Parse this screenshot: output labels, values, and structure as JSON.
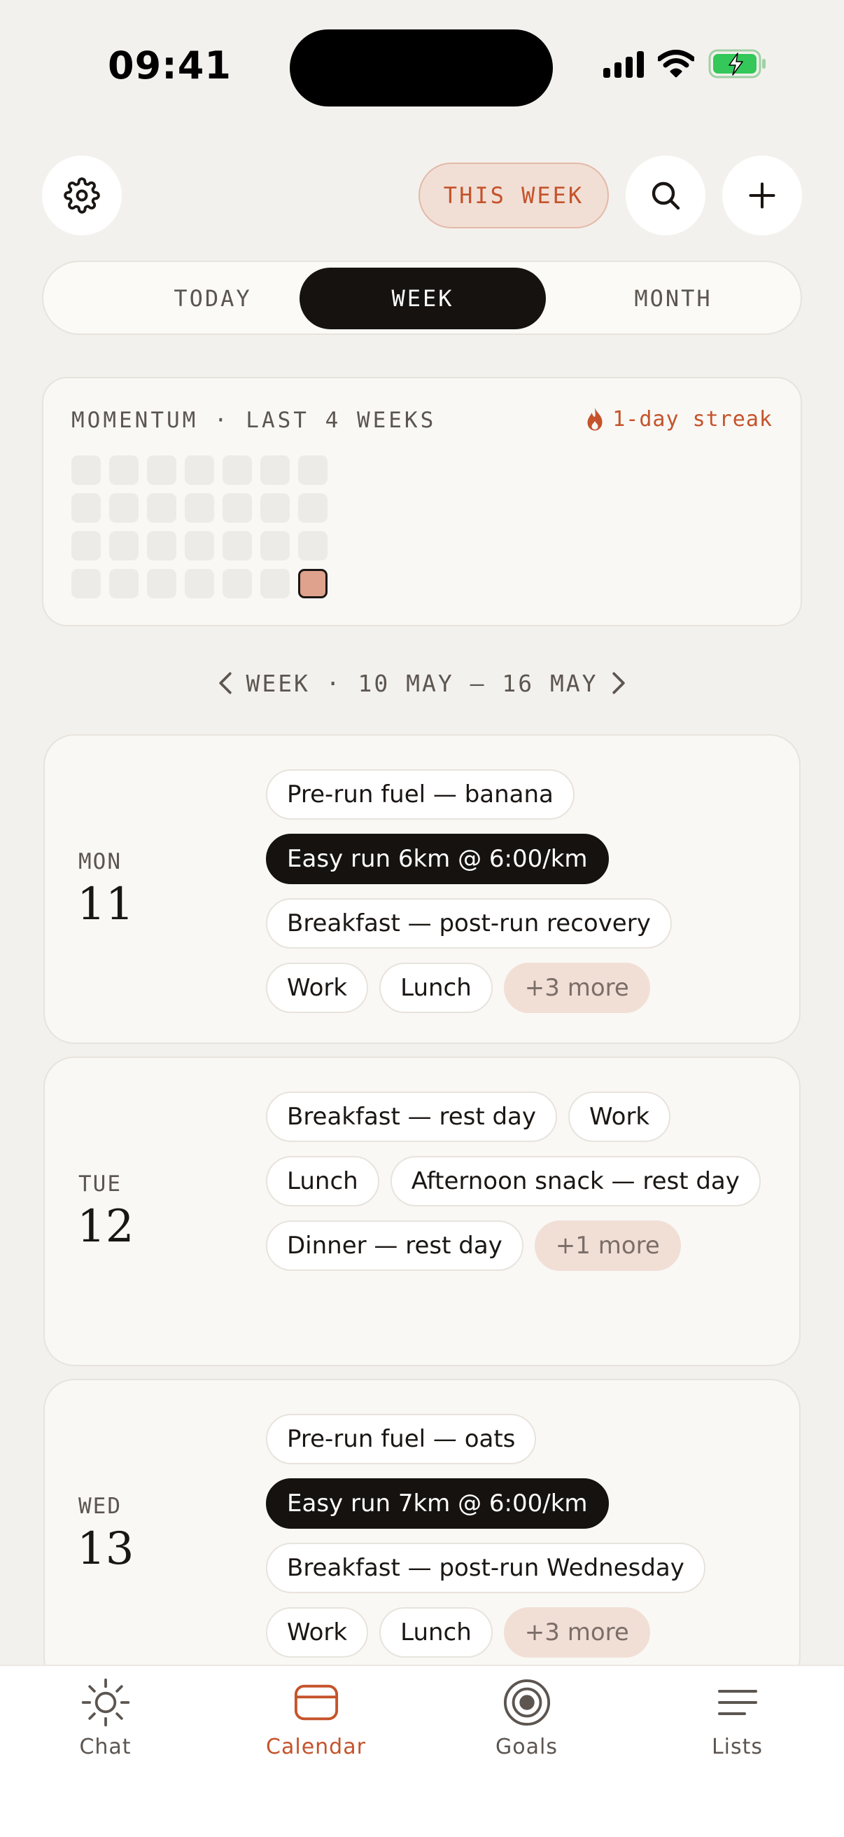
{
  "status_bar": {
    "time": "09:41"
  },
  "toolbar": {
    "settings_icon": "gear-icon",
    "this_week_label": "THIS WEEK",
    "search_icon": "search-icon",
    "add_icon": "plus-icon"
  },
  "view_switch": {
    "options": [
      "TODAY",
      "WEEK",
      "MONTH"
    ],
    "selected": "WEEK"
  },
  "momentum": {
    "title": "MOMENTUM · LAST 4 WEEKS",
    "streak": "1-day streak",
    "streak_icon": "flame-icon",
    "weeks": 4,
    "days_per_week": 7,
    "active_days": [
      27
    ]
  },
  "week_nav": {
    "label": "WEEK · 10 MAY — 16 MAY",
    "prev_icon": "chevron-left-icon",
    "next_icon": "chevron-right-icon"
  },
  "days": [
    {
      "weekday": "MON",
      "date": "11",
      "events": [
        {
          "label": "Pre-run fuel — banana",
          "style": "default"
        },
        {
          "label": "Easy run 6km @ 6:00/km",
          "style": "dark"
        },
        {
          "label": "Breakfast — post-run recovery",
          "style": "default"
        },
        {
          "label": "Work",
          "style": "default"
        },
        {
          "label": "Lunch",
          "style": "default"
        },
        {
          "label": "+3 more",
          "style": "more"
        }
      ]
    },
    {
      "weekday": "TUE",
      "date": "12",
      "events": [
        {
          "label": "Breakfast — rest day",
          "style": "default"
        },
        {
          "label": "Work",
          "style": "default"
        },
        {
          "label": "Lunch",
          "style": "default"
        },
        {
          "label": "Afternoon snack — rest day",
          "style": "default"
        },
        {
          "label": "Dinner — rest day",
          "style": "default"
        },
        {
          "label": "+1 more",
          "style": "more"
        }
      ]
    },
    {
      "weekday": "WED",
      "date": "13",
      "events": [
        {
          "label": "Pre-run fuel — oats",
          "style": "default"
        },
        {
          "label": "Easy run 7km @ 6:00/km",
          "style": "dark"
        },
        {
          "label": "Breakfast — post-run Wednesday",
          "style": "default"
        },
        {
          "label": "Work",
          "style": "default"
        },
        {
          "label": "Lunch",
          "style": "default"
        },
        {
          "label": "+3 more",
          "style": "more"
        }
      ]
    }
  ],
  "tabbar": {
    "tabs": [
      {
        "label": "Chat",
        "icon": "sun-icon"
      },
      {
        "label": "Calendar",
        "icon": "calendar-icon"
      },
      {
        "label": "Goals",
        "icon": "target-icon"
      },
      {
        "label": "Lists",
        "icon": "list-icon"
      }
    ],
    "active": "Calendar"
  },
  "colors": {
    "background": "#f3f1ed",
    "accent": "#c5532b",
    "accent_soft": "#f1dfd6",
    "dark": "#151210",
    "muted_text": "#5c5550"
  }
}
